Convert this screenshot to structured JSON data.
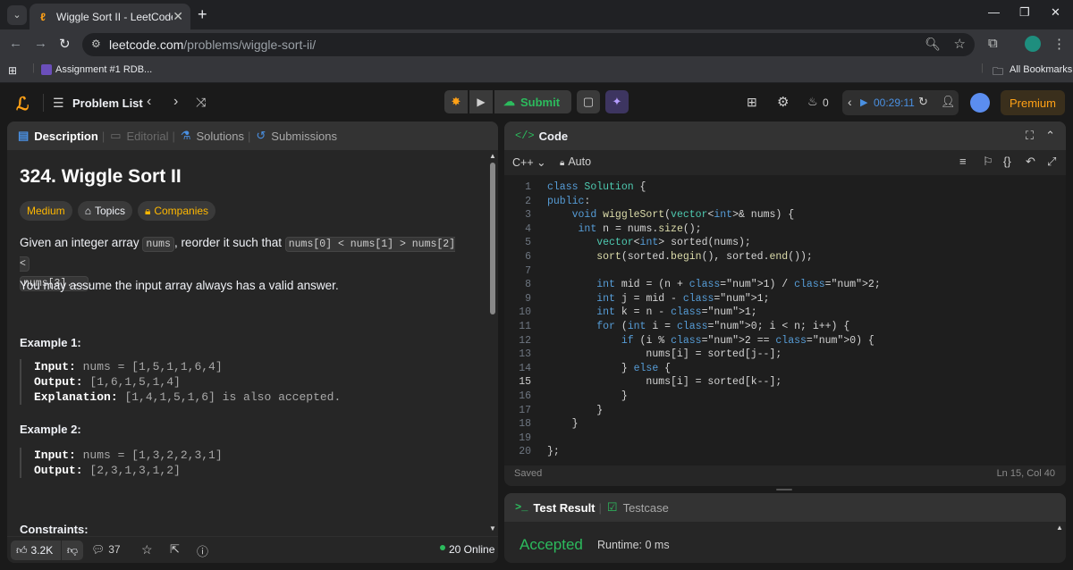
{
  "browser": {
    "tab_title": "Wiggle Sort II - LeetCode",
    "url_host": "leetcode.com",
    "url_path": "/problems/wiggle-sort-ii/",
    "bookmark": "Assignment #1 RDB...",
    "all_bookmarks": "All Bookmarks"
  },
  "nav": {
    "problem_list": "Problem List",
    "submit": "Submit",
    "fire_count": "0",
    "timer": "00:29:11",
    "premium": "Premium"
  },
  "left_tabs": [
    "Description",
    "Editorial",
    "Solutions",
    "Submissions"
  ],
  "problem": {
    "title": "324. Wiggle Sort II",
    "difficulty": "Medium",
    "topics": "Topics",
    "companies": "Companies",
    "desc_1": "Given an integer array ",
    "desc_code_1": "nums",
    "desc_2": ", reorder it such that ",
    "desc_code_2a": "nums[0] < nums[1] > nums[2] <",
    "desc_code_2b": "nums[3]...",
    "desc_3": ".",
    "assume": "You may assume the input array always has a valid answer.",
    "ex1_title": "Example 1:",
    "ex1_input_label": "Input:",
    "ex1_input": "nums = [1,5,1,1,6,4]",
    "ex1_output_label": "Output:",
    "ex1_output": "[1,6,1,5,1,4]",
    "ex1_expl_label": "Explanation:",
    "ex1_expl": "[1,4,1,5,1,6] is also accepted.",
    "ex2_title": "Example 2:",
    "ex2_input_label": "Input:",
    "ex2_input": "nums = [1,3,2,2,3,1]",
    "ex2_output_label": "Output:",
    "ex2_output": "[2,3,1,3,1,2]",
    "constraints": "Constraints:"
  },
  "left_footer": {
    "likes": "3.2K",
    "comments": "37",
    "online": "20 Online"
  },
  "code_panel": {
    "title": "Code",
    "lang": "C++",
    "auto": "Auto",
    "saved": "Saved",
    "cursor": "Ln 15, Col 40",
    "lines": [
      "class Solution {",
      "public:",
      "    void wiggleSort(vector<int>& nums) {",
      "     int n = nums.size();",
      "        vector<int> sorted(nums);",
      "        sort(sorted.begin(), sorted.end());",
      "",
      "        int mid = (n + 1) / 2;",
      "        int j = mid - 1;",
      "        int k = n - 1;",
      "        for (int i = 0; i < n; i++) {",
      "            if (i % 2 == 0) {",
      "                nums[i] = sorted[j--];",
      "            } else {",
      "                nums[i] = sorted[k--];",
      "            }",
      "        }",
      "    }",
      "",
      "};"
    ]
  },
  "result_panel": {
    "tab_result": "Test Result",
    "tab_testcase": "Testcase",
    "status": "Accepted",
    "runtime": "Runtime: 0 ms"
  },
  "colors": {
    "accent_orange": "#ffa116",
    "accepted_green": "#2cbb5d",
    "submit_green": "#2cbb5d",
    "timer_blue": "#4a90e2",
    "medium_yellow": "#ffb800"
  }
}
